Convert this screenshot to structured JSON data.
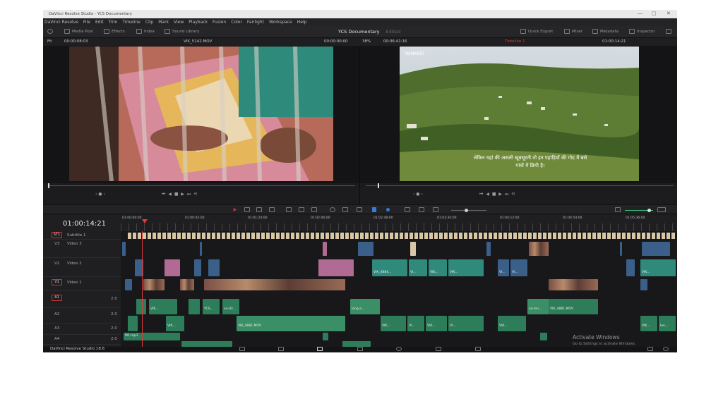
{
  "window": {
    "title": "DaVinci Resolve Studio - YCS Documentary",
    "controls": [
      "—",
      "▢",
      "✕"
    ]
  },
  "menu": [
    "DaVinci Resolve",
    "File",
    "Edit",
    "Trim",
    "Timeline",
    "Clip",
    "Mark",
    "View",
    "Playback",
    "Fusion",
    "Color",
    "Fairlight",
    "Workspace",
    "Help"
  ],
  "toolbar": {
    "media_pool": "Media Pool",
    "effects": "Effects",
    "index": "Index",
    "sound_library": "Sound Library",
    "project_name": "YCS Documentary",
    "edited": "Edited",
    "quick_export": "Quick Export",
    "mixer": "Mixer",
    "metadata": "Metadata",
    "inspector": "Inspector"
  },
  "source_viewer": {
    "zoom": "Fit",
    "timecode": "00:00:08:03",
    "clip_name": "VIK_5142.MOV",
    "position": "00:00:00:00"
  },
  "timeline_viewer": {
    "zoom": "38%",
    "duration": "00:06:41:16",
    "timeline_name": "Timeline 1",
    "timecode": "01:00:14:21",
    "watermark": "WINKART",
    "subtitle_line1": "लेकिन यहां की असली खूबसूरती तो इन पहाड़ियों की गोद में बसे",
    "subtitle_line2": "गांवों में छिपी है।"
  },
  "transport": {
    "left_ctrl": "‹ ● ›",
    "right_ctrl": "‹ ● ›",
    "buttons": "⏮  ◀  ■  ▶  ⏭  ⟲"
  },
  "timeline": {
    "current_timecode": "01:00:14:21",
    "ruler": [
      "01:00:00:00",
      "01:00:42:00",
      "01:01:24:00",
      "01:02:06:00",
      "01:02:48:00",
      "01:03:30:00",
      "01:04:12:00",
      "01:04:54:00",
      "01:05:36:00"
    ],
    "tracks": [
      {
        "tag": "ST1",
        "name": "Subtitle 1"
      },
      {
        "tag": "V3",
        "name": "Video 3"
      },
      {
        "tag": "V2",
        "name": "Video 2"
      },
      {
        "tag": "V1",
        "name": "Video 1"
      },
      {
        "tag": "A1",
        "name": "",
        "level": "2.0"
      },
      {
        "tag": "A2",
        "name": "",
        "level": "2.0"
      },
      {
        "tag": "A3",
        "name": "",
        "level": "2.0"
      },
      {
        "tag": "A4",
        "name": "",
        "level": "2.0"
      }
    ],
    "clip_labels": {
      "v2a": "VIK_4884...",
      "v2b": "VI...",
      "v2c": "VIK...",
      "v2d": "VIK...",
      "v2e": "VI...",
      "v2f": "VI...",
      "v2g": "VIK...",
      "a1a": "VIK...",
      "a1b": "YCS...",
      "a1c": "vo-02...",
      "a1d": "long e...",
      "a1e": "vo-lon...",
      "a1f": "VIK_4881.MOV",
      "a2a": "VIK...",
      "a2b": "VIK_4881.MOV",
      "a2c": "VIK...",
      "a2d": "VI...",
      "a2e": "VIK...",
      "a2f": "VI...",
      "a2g": "VIK...",
      "a2h": "VIK...",
      "a2i": "lon...",
      "a3a": "M1.mp3"
    }
  },
  "watermark": {
    "line1": "Activate Windows",
    "line2": "Go to Settings to activate Windows."
  },
  "footer": {
    "app_name": "DaVinci Resolve Studio 18.6"
  },
  "colors": {
    "accent_red": "#e03a3a",
    "bg": "#1c1c1e",
    "video_clip": "#3a5f88",
    "audio_clip": "#2e7d5a"
  }
}
